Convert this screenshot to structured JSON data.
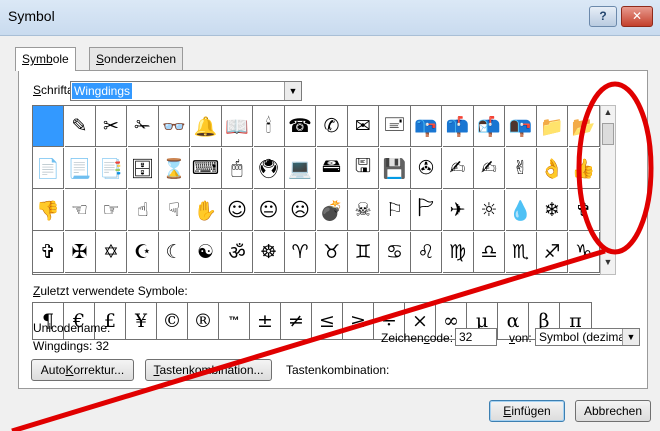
{
  "window": {
    "title": "Symbol",
    "help_label": "?",
    "close_label": "✕"
  },
  "tabs": [
    {
      "label_underlined": "Symb",
      "label_tail": "ole"
    },
    {
      "label_underlined": "S",
      "label_tail": "onderzeichen"
    }
  ],
  "font": {
    "label_prefix": "",
    "label_underlined": "S",
    "label_tail": "chriftart:",
    "value": "Wingdings"
  },
  "symbol_rows": [
    [
      "",
      "✎",
      "✂",
      "✁",
      "👓",
      "🔔",
      "📖",
      "🕯",
      "☎",
      "✆",
      "✉",
      "🖃",
      "📪",
      "📫",
      "📬",
      "📭",
      "📁",
      "📂"
    ],
    [
      "📄",
      "📃",
      "📑",
      "🗄",
      "⌛",
      "⌨",
      "🖱",
      "🖲",
      "💻",
      "🖴",
      "🖫",
      "💾",
      "✇",
      "✍",
      "✍",
      "✌",
      "👌",
      "👍"
    ],
    [
      "👎",
      "☜",
      "☞",
      "☝",
      "☟",
      "✋",
      "☺",
      "😐",
      "☹",
      "💣",
      "☠",
      "⚐",
      "🏱",
      "✈",
      "☼",
      "💧",
      "❄",
      "✞"
    ],
    [
      "✞",
      "✠",
      "✡",
      "☪",
      "☾",
      "☯",
      "ॐ",
      "☸",
      "♈",
      "♉",
      "♊",
      "♋",
      "♌",
      "♍",
      "♎",
      "♏",
      "♐",
      "♑"
    ]
  ],
  "recent": {
    "label_underlined": "Z",
    "label_tail": "uletzt verwendete Symbole:",
    "symbols": [
      "¶",
      "€",
      "£",
      "¥",
      "©",
      "®",
      "™",
      "±",
      "≠",
      "≤",
      "≥",
      "÷",
      "×",
      "∞",
      "µ",
      "α",
      "β",
      "π"
    ]
  },
  "unicode": {
    "name_label": "Unicodename:",
    "name_value": "Wingdings: 32"
  },
  "code": {
    "label_head": "Zeichen",
    "label_underlined": "c",
    "label_tail": "ode:",
    "value": "32",
    "von_underlined": "v",
    "von_tail": "on:",
    "von_value": "Symbol (dezimal)"
  },
  "buttons": {
    "autokorrektur_head": "Auto",
    "autokorrektur_underlined": "K",
    "autokorrektur_tail": "orrektur...",
    "tasten_underlined": "T",
    "tasten_tail": "astenkombination...",
    "tasten_label": "Tastenkombination:",
    "insert_underlined": "E",
    "insert_tail": "infügen",
    "cancel_label": "Abbrechen"
  },
  "colors": {
    "selection": "#3399ff",
    "annotation": "#e00000"
  }
}
